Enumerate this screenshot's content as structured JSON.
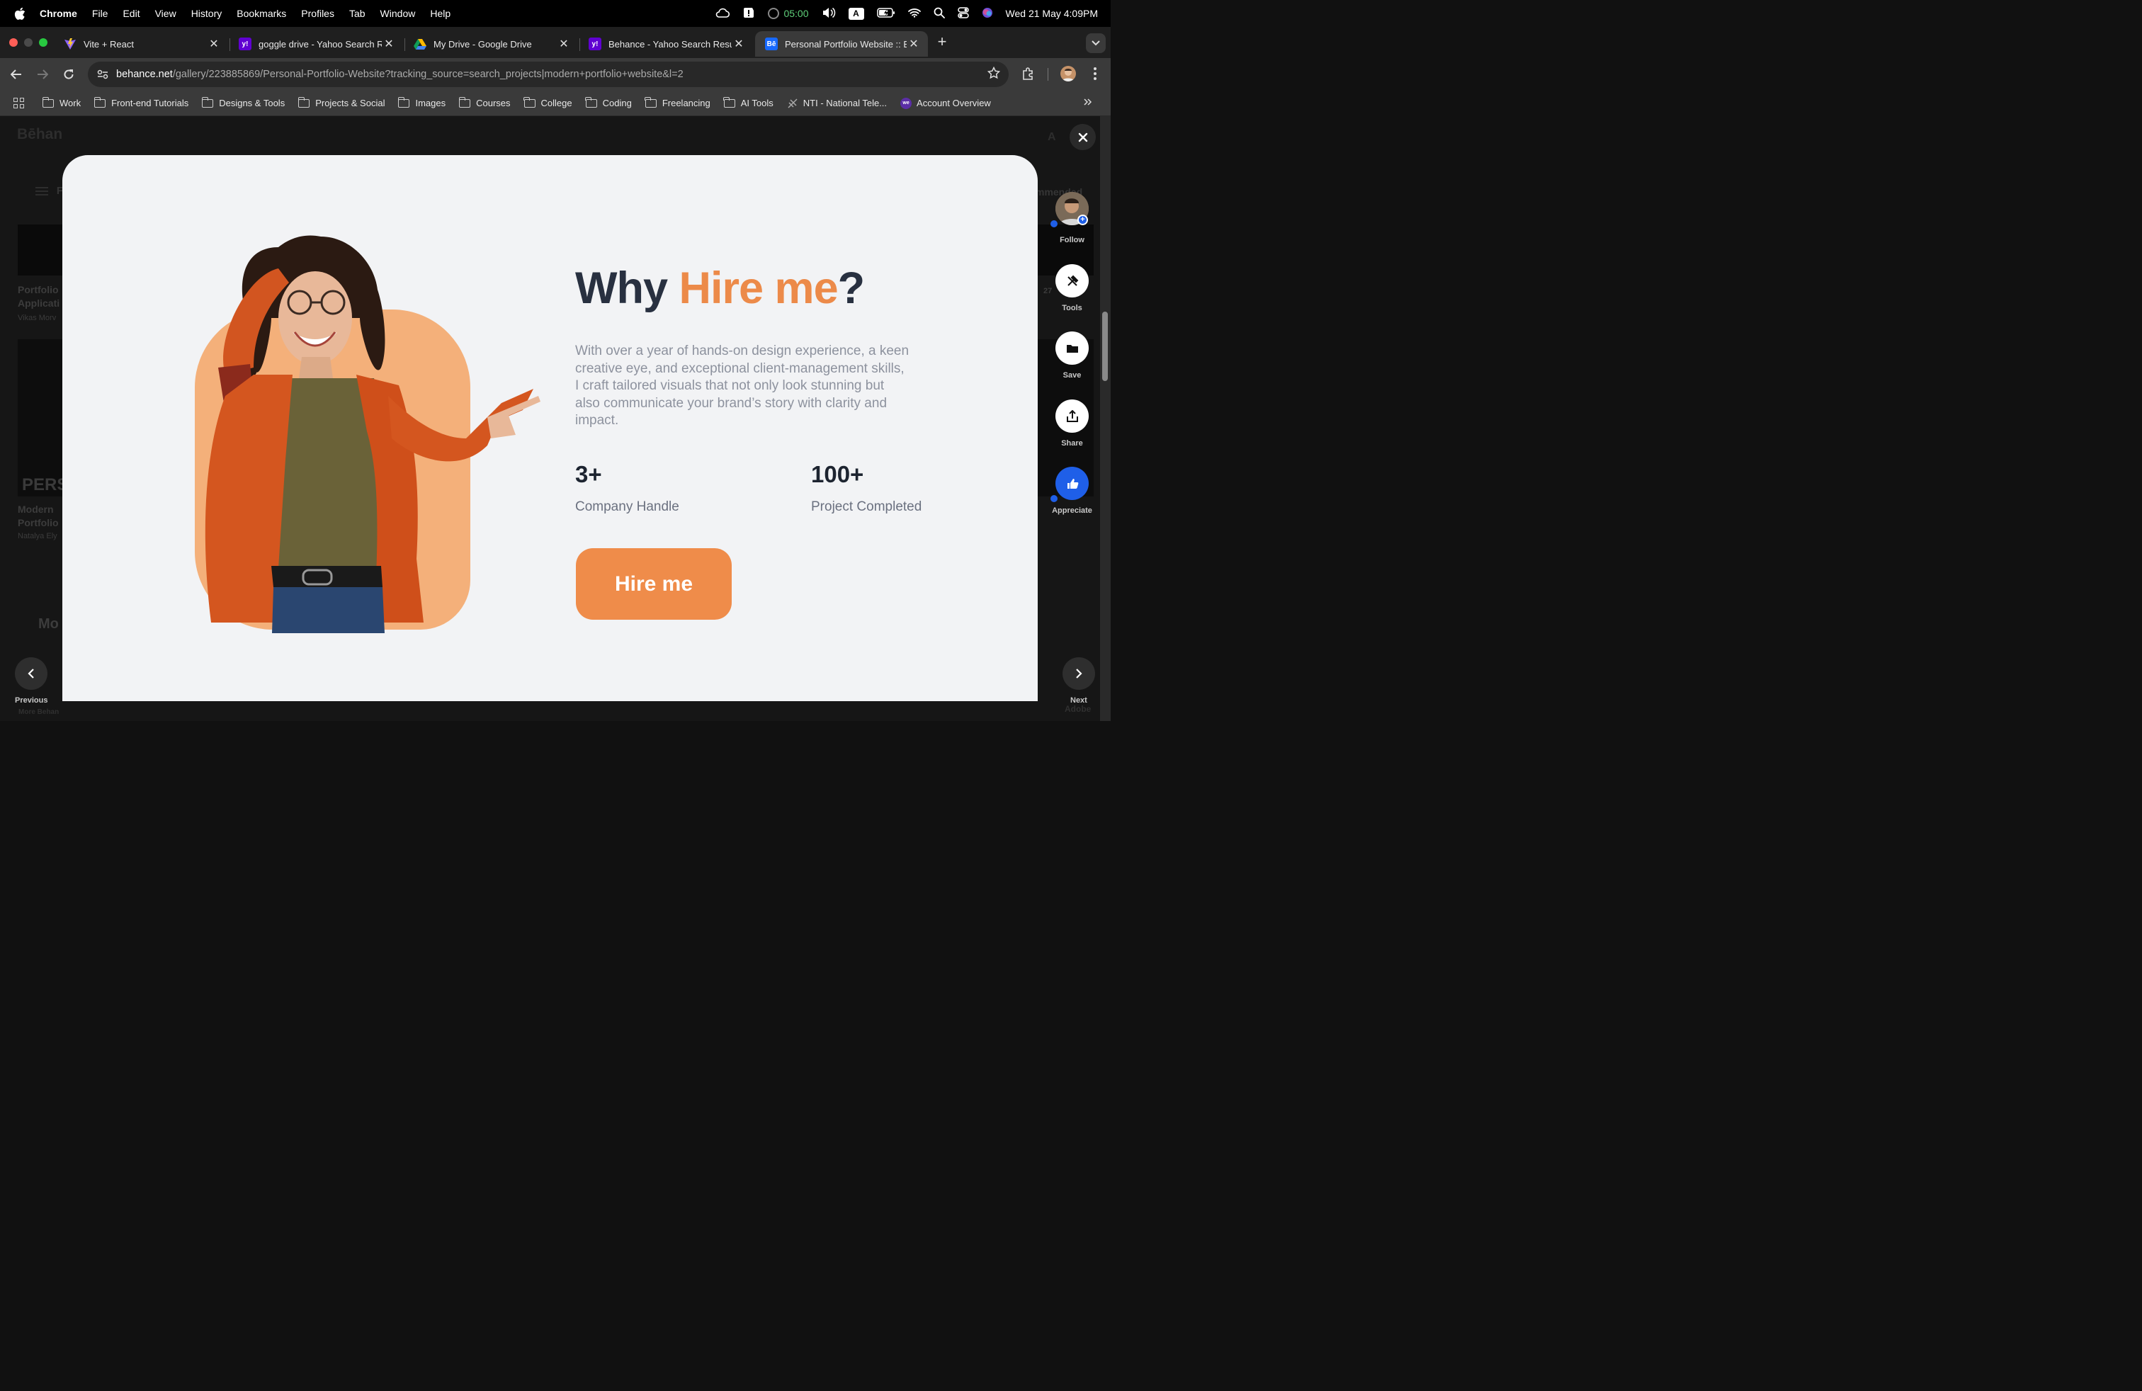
{
  "menubar": {
    "app_name": "Chrome",
    "items": [
      "File",
      "Edit",
      "View",
      "History",
      "Bookmarks",
      "Profiles",
      "Tab",
      "Window",
      "Help"
    ],
    "timer": "05:00",
    "input_source": "A",
    "datetime": "Wed 21 May  4:09PM"
  },
  "tabs": [
    {
      "title": "Vite + React",
      "favicon": "vite-icon",
      "color": "#8c63ff"
    },
    {
      "title": "goggle drive - Yahoo Search Results",
      "favicon": "yahoo-icon",
      "color": "#6001d2"
    },
    {
      "title": "My Drive - Google Drive",
      "favicon": "google-drive-icon",
      "color": "#1fa463"
    },
    {
      "title": "Behance - Yahoo Search Results",
      "favicon": "yahoo-icon",
      "color": "#6001d2"
    },
    {
      "title": "Personal Portfolio Website :: Behance",
      "favicon": "behance-icon",
      "color": "#1769ff"
    }
  ],
  "address_bar": {
    "host": "behance.net",
    "path": "/gallery/223885869/Personal-Portfolio-Website?tracking_source=search_projects|modern+portfolio+website&l=2"
  },
  "bookmarks": [
    {
      "label": "Work",
      "type": "folder"
    },
    {
      "label": "Front-end Tutorials",
      "type": "folder"
    },
    {
      "label": "Designs & Tools",
      "type": "folder"
    },
    {
      "label": "Projects & Social",
      "type": "folder"
    },
    {
      "label": "Images",
      "type": "folder"
    },
    {
      "label": "Courses",
      "type": "folder"
    },
    {
      "label": "College",
      "type": "folder"
    },
    {
      "label": "Coding",
      "type": "folder"
    },
    {
      "label": "Freelancing",
      "type": "folder"
    },
    {
      "label": "AI Tools",
      "type": "folder"
    },
    {
      "label": "NTI - National Tele...",
      "type": "site"
    },
    {
      "label": "Account Overview",
      "type": "site"
    }
  ],
  "background": {
    "logo": "Bēhan",
    "filter_label": "F",
    "sort_label": "mmended",
    "card1_title": "Portfolio Applicati",
    "card1_author": "Vikas Morv",
    "card2_title": "Modern Portfolio",
    "card2_author": "Natalya Ely",
    "card2_text": "PERS",
    "more_heading": "Mo",
    "stat_label": "27",
    "adobe_label": "Adobe",
    "more_behance": "More Behan"
  },
  "modal": {
    "headline_prefix": "Why ",
    "headline_accent": "Hire me",
    "headline_suffix": "?",
    "description": "With over a year of hands-on design experience, a keen creative eye, and exceptional client-management skills, I craft tailored visuals that not only look stunning but also communicate your brand’s story with clarity and impact.",
    "stats": [
      {
        "value": "3+",
        "label": "Company Handle"
      },
      {
        "value": "100+",
        "label": "Project Completed"
      }
    ],
    "cta": "Hire me",
    "accent_color": "#ec8a49"
  },
  "rail": {
    "follow": "Follow",
    "tools": "Tools",
    "save": "Save",
    "share": "Share",
    "appreciate": "Appreciate"
  },
  "pager": {
    "previous": "Previous",
    "next": "Next"
  }
}
